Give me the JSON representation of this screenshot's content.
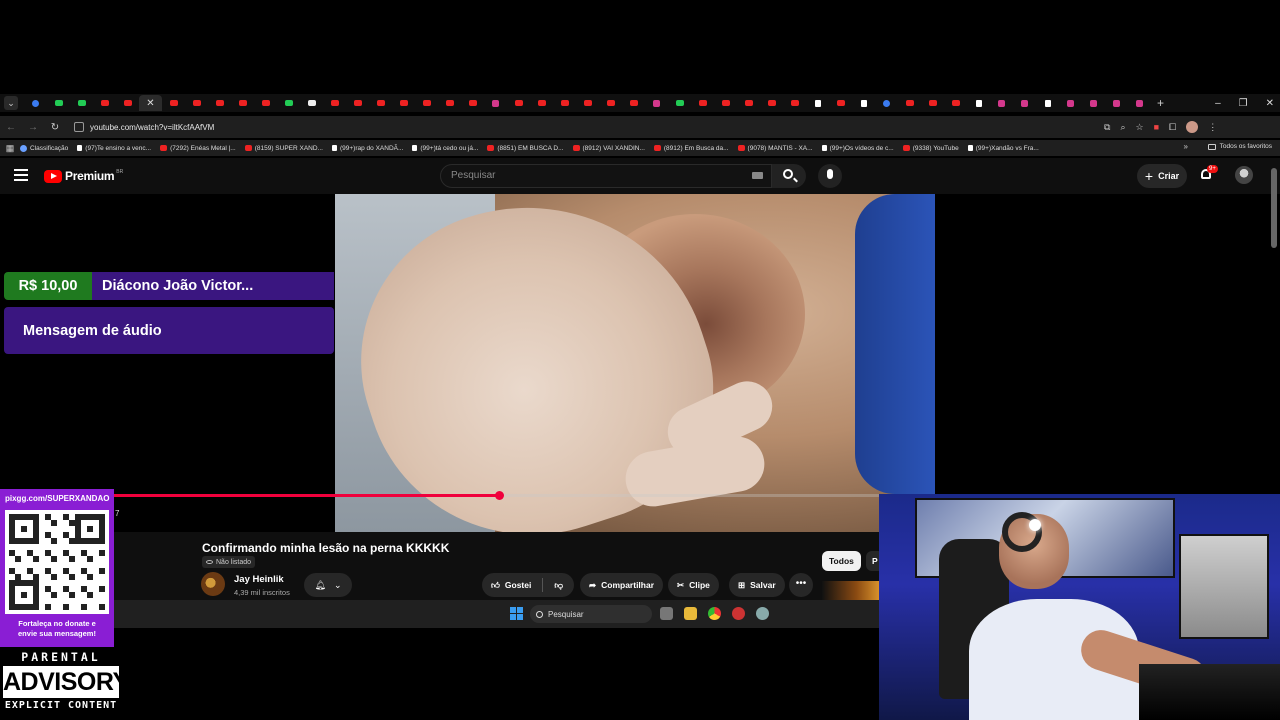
{
  "browser": {
    "url": "youtube.com/watch?v=iltKcfAAfVM",
    "bookmarks": [
      {
        "label": "Classificação",
        "icon": "clock-icon"
      },
      {
        "label": "(97)Te ensino a venc...",
        "icon": "tiktok-icon"
      },
      {
        "label": "(7292) Enéas Metal |...",
        "icon": "youtube-icon"
      },
      {
        "label": "(8159) SUPER XAND...",
        "icon": "youtube-icon"
      },
      {
        "label": "(99+)rap do XANDÃ...",
        "icon": "tiktok-icon"
      },
      {
        "label": "(99+)tá cedo ou já...",
        "icon": "tiktok-icon"
      },
      {
        "label": "(8851) EM BUSCA D...",
        "icon": "youtube-icon"
      },
      {
        "label": "(8912) VAI XANDIN...",
        "icon": "youtube-icon"
      },
      {
        "label": "(8912) Em Busca da...",
        "icon": "youtube-icon"
      },
      {
        "label": "(9078) MANTIS - XA...",
        "icon": "youtube-icon"
      },
      {
        "label": "(99+)Os vídeos de c...",
        "icon": "tiktok-icon"
      },
      {
        "label": "(9338) YouTube",
        "icon": "youtube-icon"
      },
      {
        "label": "(99+)Xandão vs Fra...",
        "icon": "tiktok-icon"
      }
    ],
    "all_bookmarks_label": "Todos os favoritos",
    "accent_color": "#e22222"
  },
  "youtube": {
    "logo_text": "Premium",
    "country_code": "BR",
    "search_placeholder": "Pesquisar",
    "create_label": "Criar",
    "notification_count": "9+",
    "video": {
      "title": "Confirmando minha lesão na perna KKKKK",
      "visibility": "Não listado",
      "progress": 0.47,
      "progress_color": "#f0003c"
    },
    "channel": {
      "name": "Jay Heinlik",
      "subscribers": "4,39 mil inscritos"
    },
    "actions": {
      "like": "Gostei",
      "share": "Compartilhar",
      "clip": "Clipe",
      "save": "Salvar"
    },
    "chips": [
      "Todos",
      "P"
    ]
  },
  "taskbar": {
    "search_placeholder": "Pesquisar"
  },
  "overlay": {
    "donation": {
      "amount": "R$ 10,00",
      "donor": "Diácono João Victor...",
      "message": "Mensagem de áudio"
    },
    "pix": {
      "url": "pixgg.com/SUPERXANDAO",
      "caption_line1": "Fortaleça no donate e",
      "caption_line2": "envie sua mensagem!"
    },
    "time_fragment": "7",
    "advisory": {
      "top": "PARENTAL",
      "middle": "ADVISORY",
      "bottom": "EXPLICIT CONTENT"
    }
  }
}
